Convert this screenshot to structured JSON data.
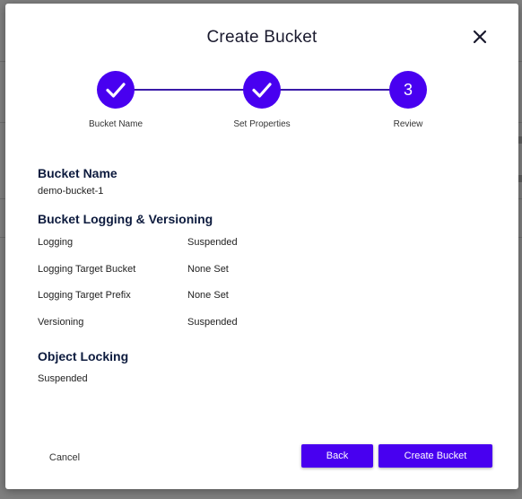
{
  "modal": {
    "title": "Create Bucket"
  },
  "stepper": {
    "steps": [
      {
        "label": "Bucket Name",
        "status": "completed"
      },
      {
        "label": "Set Properties",
        "status": "completed"
      },
      {
        "label": "Review",
        "status": "current",
        "number": "3"
      }
    ]
  },
  "review": {
    "bucket_name_title": "Bucket Name",
    "bucket_name_value": "demo-bucket-1",
    "logging_title": "Bucket Logging & Versioning",
    "rows": [
      {
        "label": "Logging",
        "value": "Suspended"
      },
      {
        "label": "Logging Target Bucket",
        "value": "None Set"
      },
      {
        "label": "Logging Target Prefix",
        "value": "None Set"
      },
      {
        "label": "Versioning",
        "value": "Suspended"
      }
    ],
    "object_locking_title": "Object Locking",
    "object_locking_value": "Suspended"
  },
  "footer": {
    "cancel_label": "Cancel",
    "back_label": "Back",
    "create_label": "Create Bucket"
  },
  "colors": {
    "accent": "#4800f0",
    "overlay": "#7f7f7f",
    "heading": "#0d1b3e"
  }
}
